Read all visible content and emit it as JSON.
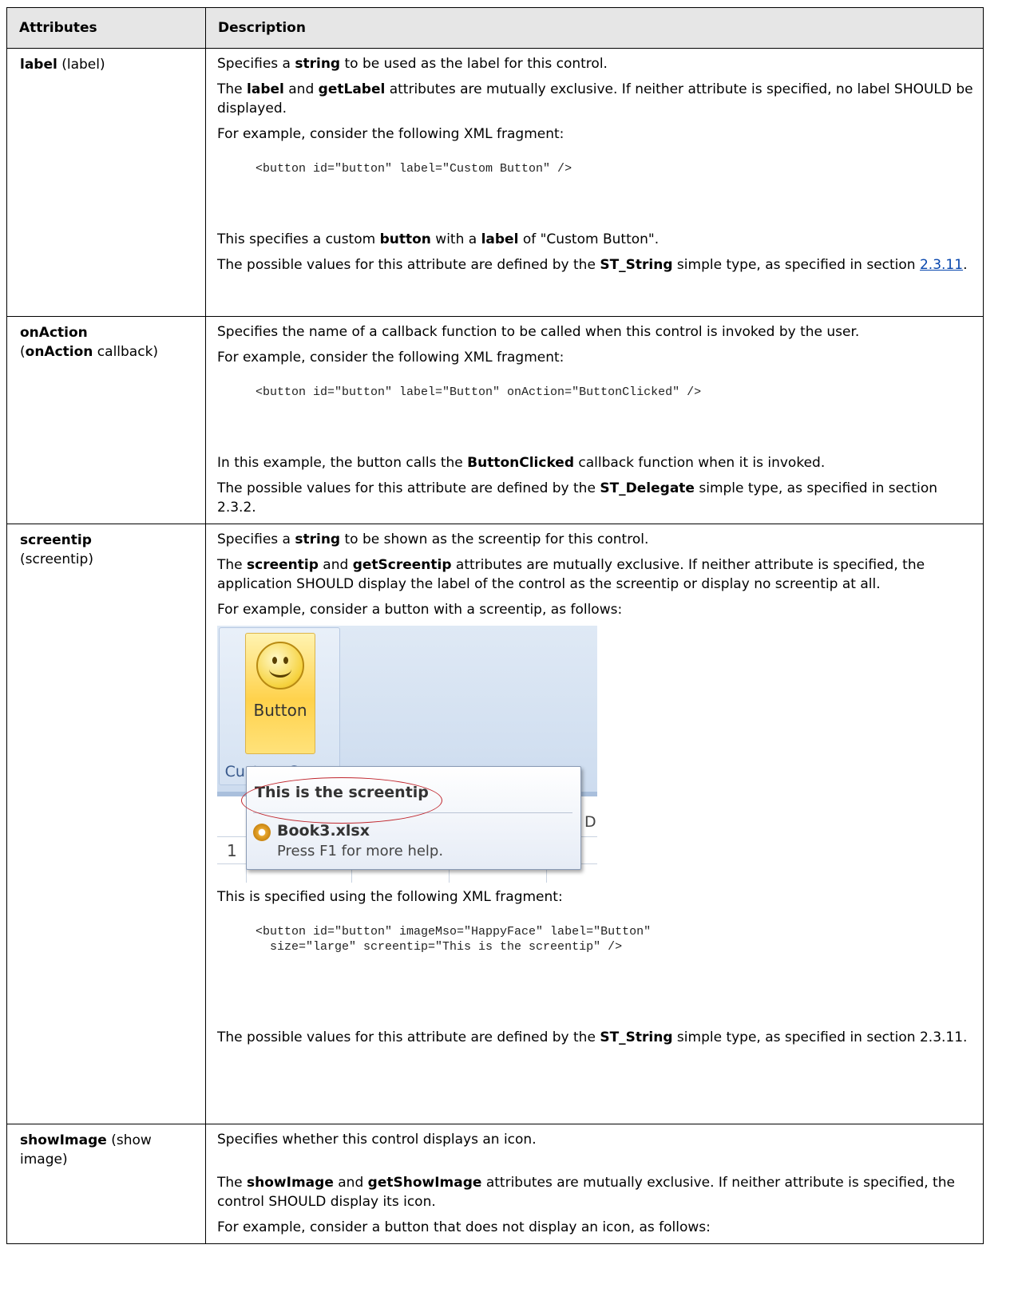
{
  "table": {
    "header_attributes": "Attributes",
    "header_description": "Description"
  },
  "label_row": {
    "name": "label",
    "name_suffix": " (label)",
    "p1_a": "Specifies a ",
    "p1_b": "string",
    "p1_c": " to be used as the label for this control.",
    "p2_a": "The ",
    "p2_b": "label",
    "p2_c": " and ",
    "p2_d": "getLabel",
    "p2_e": " attributes are mutually exclusive. If neither attribute is specified, no label SHOULD be displayed.",
    "p3": "For example, consider the following XML fragment:",
    "code": "<button id=\"button\" label=\"Custom Button\" />",
    "p4_a": "This specifies a custom ",
    "p4_b": "button",
    "p4_c": " with a ",
    "p4_d": "label",
    "p4_e": " of \"Custom Button\".",
    "p5_a": "The possible values for this attribute are defined by the ",
    "p5_b": "ST_String",
    "p5_c": " simple type, as specified in section ",
    "p5_link": "2.3.11",
    "p5_d": "."
  },
  "onaction_row": {
    "name": "onAction",
    "name_2a": "(",
    "name_2b": "onAction",
    "name_2c": " callback)",
    "p1": "Specifies the name of a callback function to be called when this control is invoked by the user.",
    "p2": "For example, consider the following XML fragment:",
    "code": "<button id=\"button\" label=\"Button\" onAction=\"ButtonClicked\" />",
    "p3_a": "In this example, the button calls the ",
    "p3_b": "ButtonClicked",
    "p3_c": " callback function when it is invoked.",
    "p4_a": "The possible values for this attribute are defined by the ",
    "p4_b": "ST_Delegate",
    "p4_c": " simple type, as specified in section 2.3.2."
  },
  "screentip_row": {
    "name": "screentip",
    "name_suffix": "(screentip)",
    "p1_a": "Specifies a ",
    "p1_b": "string",
    "p1_c": " to be shown as the screentip for this control.",
    "p2_a": "The ",
    "p2_b": "screentip",
    "p2_c": " and ",
    "p2_d": "getScreentip",
    "p2_e": " attributes are mutually exclusive. If neither attribute is specified, the application SHOULD display the label of the control as the screentip or display no screentip at all.",
    "p3": "For example, consider a button with a screentip, as follows:",
    "shot": {
      "button_label": "Button",
      "group_label": "Custom Group",
      "tip_title": "This is the screentip",
      "tip_file": "Book3.xlsx",
      "tip_help": "Press F1 for more help.",
      "row_1": "1",
      "col_letter": "D"
    },
    "p4": "This is specified using the following XML fragment:",
    "code": "<button id=\"button\" imageMso=\"HappyFace\" label=\"Button\"\n  size=\"large\" screentip=\"This is the screentip\" />",
    "p5_a": "The possible values for this attribute are defined by the ",
    "p5_b": "ST_String",
    "p5_c": " simple type, as specified in section 2.3.11."
  },
  "showimage_row": {
    "name": "showImage",
    "name_suffix": " (show image)",
    "p1": "Specifies whether this control displays an icon.",
    "p2_a": "The ",
    "p2_b": "showImage",
    "p2_c": " and ",
    "p2_d": "getShowImage",
    "p2_e": " attributes are mutually exclusive. If neither attribute is specified, the control SHOULD display its icon.",
    "p3": "For example, consider a button that does not display an icon, as follows:"
  }
}
